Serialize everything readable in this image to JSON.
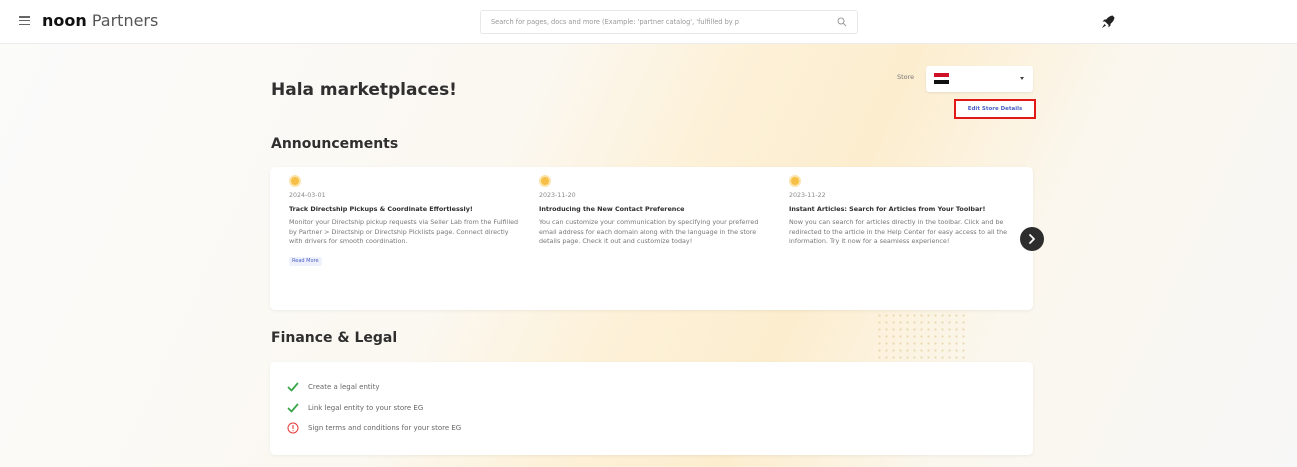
{
  "topbar": {
    "brand_bold": "noon",
    "brand_rest": "Partners",
    "search_placeholder": "Search for pages, docs and more (Example: 'partner catalog', 'fulfilled by p",
    "menu_icon": "hamburger-menu-icon",
    "search_icon": "search-icon",
    "rocket_icon": "rocket-icon"
  },
  "greeting": "Hala marketplaces!",
  "store": {
    "label": "Store",
    "selected_flag": "egypt-flag",
    "flag_colors": [
      "#ce1126",
      "#ffffff",
      "#000000"
    ],
    "edit_button": "Edit Store Details",
    "highlight_color": "#e01818"
  },
  "announcements": {
    "title": "Announcements",
    "items": [
      {
        "date": "2024-03-01",
        "title": "Track Directship Pickups & Coordinate Effortlessly!",
        "body": "Monitor your Directship pickup requests via Seller Lab from the Fulfilled by Partner > Directship or Directship Picklists page. Connect directly with drivers for smooth coordination.",
        "read_more": "Read More"
      },
      {
        "date": "2023-11-20",
        "title": "Introducing the New Contact Preference",
        "body": "You can customize your communication by specifying your preferred email address for each domain along with the language in the store details page. Check it out and customize today!"
      },
      {
        "date": "2023-11-22",
        "title": "Instant Articles: Search for Articles from Your Toolbar!",
        "body": "Now you can search for articles directly in the toolbar. Click and be redirected to the article in the Help Center for easy access to all the information. Try it now for a seamless experience!"
      }
    ],
    "next_icon": "chevron-right-icon"
  },
  "finance": {
    "title": "Finance & Legal",
    "tasks": [
      {
        "label": "Create a legal entity",
        "status": "done"
      },
      {
        "label": "Link legal entity to your store EG",
        "status": "done"
      },
      {
        "label": "Sign terms and conditions for your store EG",
        "status": "pending"
      }
    ],
    "done_color": "#3aa64a",
    "pending_color": "#e23b3b"
  }
}
